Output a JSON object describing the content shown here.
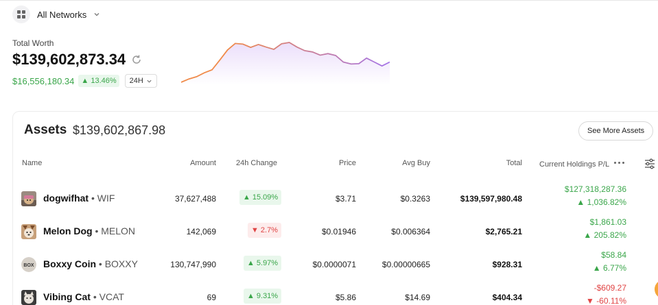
{
  "network": {
    "label": "All Networks"
  },
  "summary": {
    "total_label": "Total Worth",
    "total_value": "$139,602,873.34",
    "change_value": "$16,556,180.34",
    "change_pct": "13.46%",
    "period": "24H"
  },
  "sparkline": {
    "values": [
      0.04,
      0.14,
      0.21,
      0.33,
      0.42,
      0.72,
      1.03,
      1.23,
      1.21,
      1.11,
      1.2,
      1.12,
      1.05,
      1.22,
      1.26,
      1.12,
      1.01,
      0.97,
      0.87,
      0.92,
      0.86,
      0.66,
      0.6,
      0.61,
      0.78,
      0.66,
      0.54,
      0.66
    ],
    "gradient_from": "#f08b4a",
    "gradient_to": "#a474e8"
  },
  "assets": {
    "title": "Assets",
    "value": "$139,602,867.98",
    "see_more": "See More Assets",
    "columns": {
      "name": "Name",
      "amount": "Amount",
      "change": "24h Change",
      "price": "Price",
      "avg_buy": "Avg Buy",
      "total": "Total",
      "pl": "Current Holdings P/L"
    },
    "rows": [
      {
        "name": "dogwifhat",
        "symbol": "• WIF",
        "amount": "37,627,488",
        "change": "15.09%",
        "change_dir": "up",
        "price": "$3.71",
        "avg_buy": "$0.3263",
        "total": "$139,597,980.48",
        "pl_value": "$127,318,287.36",
        "pl_pct": "1,036.82%",
        "pl_dir": "up",
        "icon": "wif-avatar"
      },
      {
        "name": "Melon Dog",
        "symbol": "• MELON",
        "amount": "142,069",
        "change": "2.7%",
        "change_dir": "down",
        "price": "$0.01946",
        "avg_buy": "$0.006364",
        "total": "$2,765.21",
        "pl_value": "$1,861.03",
        "pl_pct": "205.82%",
        "pl_dir": "up",
        "icon": "melon-avatar"
      },
      {
        "name": "Boxxy Coin",
        "symbol": "• BOXXY",
        "amount": "130,747,990",
        "change": "5.97%",
        "change_dir": "up",
        "price": "$0.0000071",
        "avg_buy": "$0.00000665",
        "total": "$928.31",
        "pl_value": "$58.84",
        "pl_pct": "6.77%",
        "pl_dir": "up",
        "icon": "boxxy-avatar"
      },
      {
        "name": "Vibing Cat",
        "symbol": "• VCAT",
        "amount": "69",
        "change": "9.31%",
        "change_dir": "up",
        "price": "$5.86",
        "avg_buy": "$14.69",
        "total": "$404.34",
        "pl_value": "-$609.27",
        "pl_pct": "-60.11%",
        "pl_dir": "down",
        "icon": "vcat-avatar"
      }
    ]
  },
  "colors": {
    "positive": "#3aa64a",
    "negative": "#e04444",
    "positive_bg": "#e9f7ec",
    "negative_bg": "#fdecec"
  }
}
